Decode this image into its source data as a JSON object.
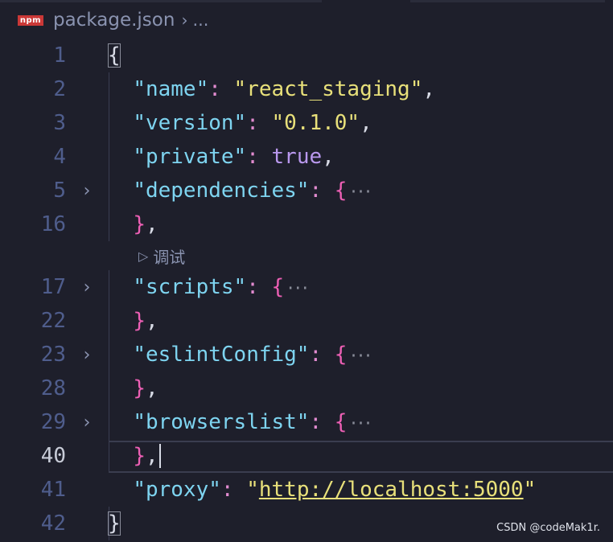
{
  "breadcrumb": {
    "file_icon_label": "npm",
    "file_name": "package.json",
    "separator": "›",
    "more": "..."
  },
  "editor": {
    "lines": [
      {
        "num": "1",
        "open_brace": "{"
      },
      {
        "num": "2",
        "key": "\"name\"",
        "colon": ": ",
        "value": "\"react_staging\"",
        "comma": ","
      },
      {
        "num": "3",
        "key": "\"version\"",
        "colon": ": ",
        "value": "\"0.1.0\"",
        "comma": ","
      },
      {
        "num": "4",
        "key": "\"private\"",
        "colon": ": ",
        "value": "true",
        "comma": ","
      },
      {
        "num": "5",
        "key": "\"dependencies\"",
        "colon": ": ",
        "value": "{",
        "ellipsis": "···"
      },
      {
        "num": "16",
        "value": "}",
        "comma": ","
      },
      {
        "num": "17",
        "key": "\"scripts\"",
        "colon": ": ",
        "value": "{",
        "ellipsis": "···"
      },
      {
        "num": "22",
        "value": "}",
        "comma": ","
      },
      {
        "num": "23",
        "key": "\"eslintConfig\"",
        "colon": ": ",
        "value": "{",
        "ellipsis": "···"
      },
      {
        "num": "28",
        "value": "}",
        "comma": ","
      },
      {
        "num": "29",
        "key": "\"browserslist\"",
        "colon": ": ",
        "value": "{",
        "ellipsis": "···"
      },
      {
        "num": "40",
        "value": "}",
        "comma": ","
      },
      {
        "num": "41",
        "key": "\"proxy\"",
        "colon": ": ",
        "quote_open": "\"",
        "url": "http://localhost:5000",
        "quote_close": "\""
      },
      {
        "num": "42",
        "close_brace": "}"
      }
    ],
    "codelens": {
      "icon": "▷",
      "label": "调试"
    }
  },
  "watermark": "CSDN @codeMak1r.",
  "colors": {
    "background": "#1e1f2b",
    "key": "#7ed4f0",
    "string": "#e8e07a",
    "boolean": "#b998ee",
    "brace": "#ec5fb4",
    "line_number": "#4f5d8c"
  }
}
